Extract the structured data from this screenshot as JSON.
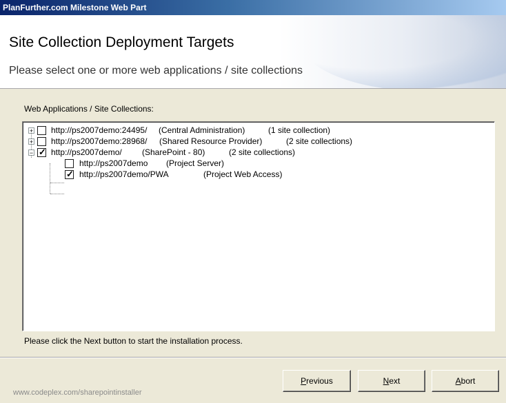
{
  "window": {
    "title": "PlanFurther.com Milestone Web Part"
  },
  "header": {
    "title": "Site Collection Deployment Targets",
    "subtitle": "Please select one or more web applications / site collections"
  },
  "tree_label": "Web Applications / Site Collections:",
  "tree": {
    "nodes": [
      {
        "url": "http://ps2007demo:24495/",
        "name": "(Central Administration)",
        "info": "(1 site collection)",
        "expanded": false,
        "checked": false
      },
      {
        "url": "http://ps2007demo:28968/",
        "name": "(Shared Resource Provider)",
        "info": "(2 site collections)",
        "expanded": false,
        "checked": false
      },
      {
        "url": "http://ps2007demo/",
        "name": "(SharePoint - 80)",
        "info": "(2 site collections)",
        "expanded": true,
        "checked": true,
        "children": [
          {
            "url": "http://ps2007demo",
            "name": "(Project Server)",
            "checked": false
          },
          {
            "url": "http://ps2007demo/PWA",
            "name": "(Project Web Access)",
            "checked": true
          }
        ]
      }
    ]
  },
  "hint": "Please click the Next button to start the installation process.",
  "buttons": {
    "previous": {
      "key": "P",
      "rest": "revious"
    },
    "next": {
      "key": "N",
      "rest": "ext"
    },
    "abort": {
      "key": "A",
      "rest": "bort"
    }
  },
  "footer": "www.codeplex.com/sharepointinstaller",
  "icons": {
    "expand": "plus-expander-icon",
    "collapse": "minus-expander-icon",
    "check": "checkmark-icon"
  }
}
